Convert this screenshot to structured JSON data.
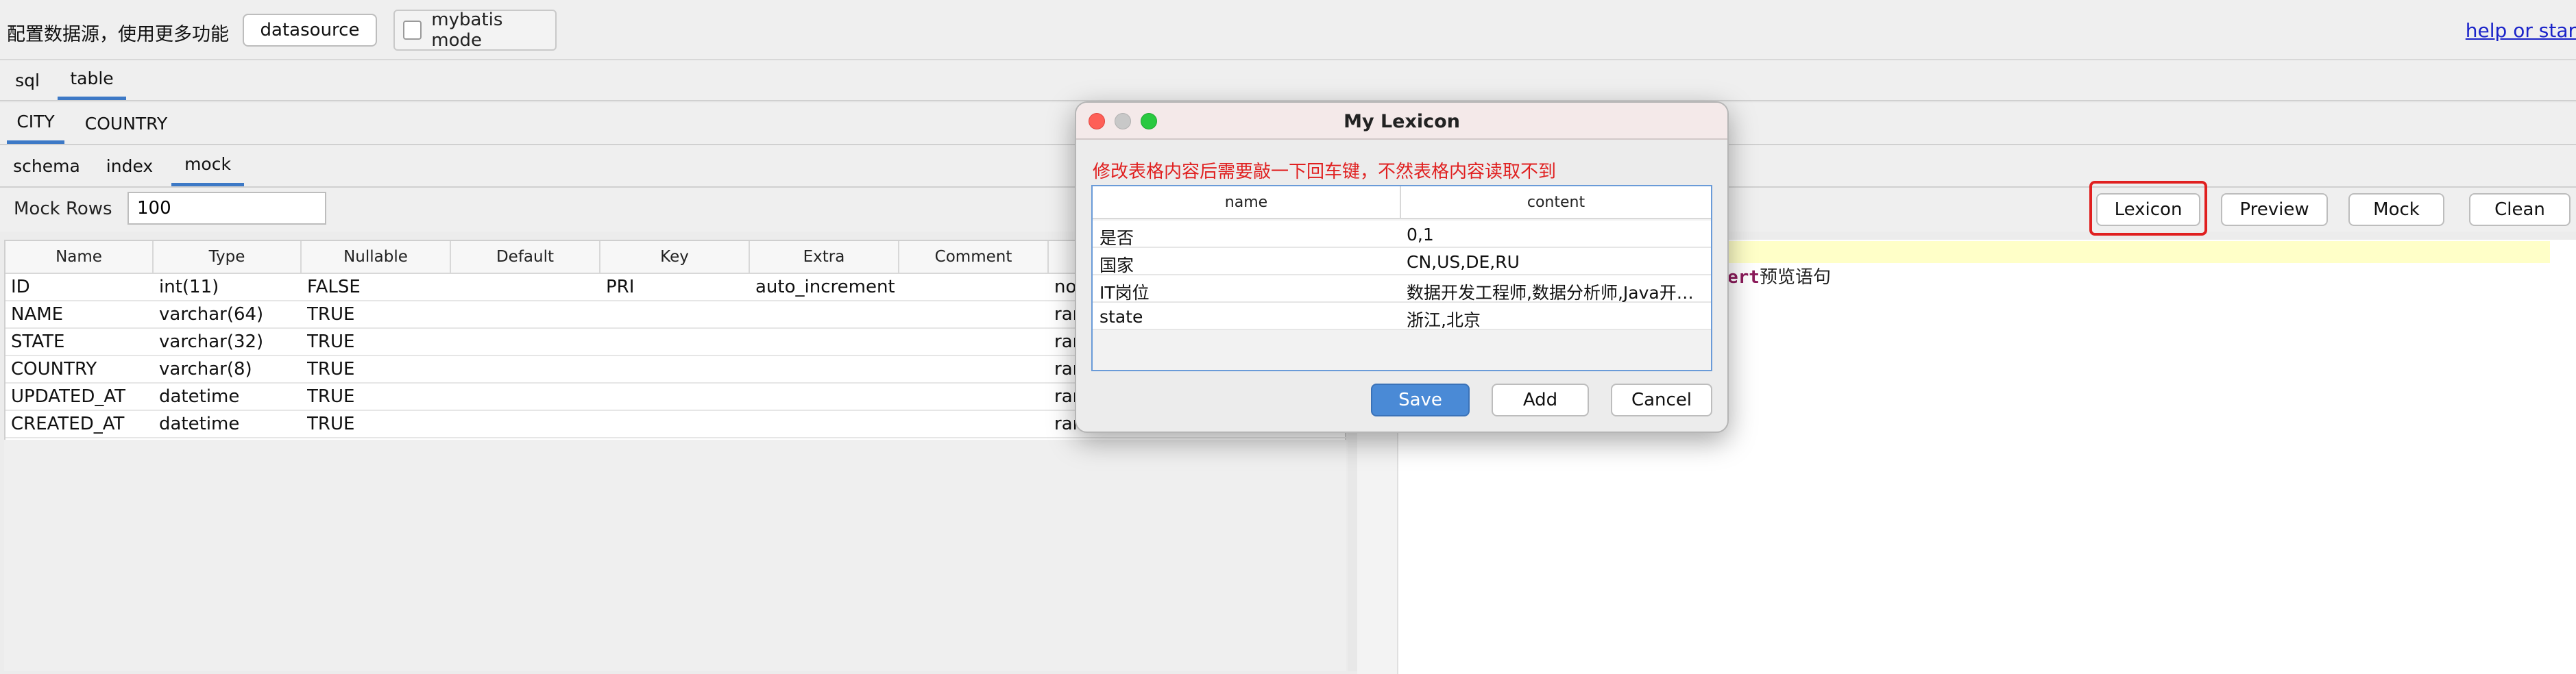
{
  "topbar": {
    "config_text": "配置数据源，使用更多功能",
    "datasource_button": "datasource",
    "mybatis_label": "mybatis mode",
    "help_link": "help or star"
  },
  "mode_tabs": [
    "sql",
    "table"
  ],
  "table_tabs": [
    "CITY",
    "COUNTRY"
  ],
  "sub_tabs": [
    "schema",
    "index",
    "mock"
  ],
  "mock": {
    "rows_label": "Mock Rows",
    "rows_value": "100",
    "buttons": {
      "lexicon": "Lexicon",
      "preview": "Preview",
      "mock": "Mock",
      "clean": "Clean"
    }
  },
  "schema_table": {
    "headers": [
      "Name",
      "Type",
      "Nullable",
      "Default",
      "Key",
      "Extra",
      "Comment",
      ""
    ],
    "rows": [
      [
        "ID",
        "int(11)",
        "FALSE",
        "",
        "PRI",
        "auto_increment",
        "",
        "non"
      ],
      [
        "NAME",
        "varchar(64)",
        "TRUE",
        "",
        "",
        "",
        "",
        "ran"
      ],
      [
        "STATE",
        "varchar(32)",
        "TRUE",
        "",
        "",
        "",
        "",
        "ran"
      ],
      [
        "COUNTRY",
        "varchar(8)",
        "TRUE",
        "",
        "",
        "",
        "",
        "ran"
      ],
      [
        "UPDATED_AT",
        "datetime",
        "TRUE",
        "",
        "",
        "",
        "",
        "ran"
      ],
      [
        "CREATED_AT",
        "datetime",
        "TRUE",
        "",
        "",
        "",
        "",
        "ran"
      ]
    ]
  },
  "editor": {
    "keyword": "ert",
    "text": "预览语句"
  },
  "dialog": {
    "title": "My Lexicon",
    "warning": "修改表格内容后需要敲一下回车键，不然表格内容读取不到",
    "headers": [
      "name",
      "content"
    ],
    "rows": [
      [
        "是否",
        "0,1"
      ],
      [
        "国家",
        "CN,US,DE,RU"
      ],
      [
        "IT岗位",
        "数据开发工程师,数据分析师,Java开发工程师"
      ],
      [
        "state",
        "浙江,北京"
      ]
    ],
    "buttons": {
      "save": "Save",
      "add": "Add",
      "cancel": "Cancel"
    }
  },
  "colors": {
    "accent": "#3d79c6",
    "highlight_box": "#e02020",
    "warning_text": "#e02020",
    "save_button": "#4a8ad6"
  }
}
